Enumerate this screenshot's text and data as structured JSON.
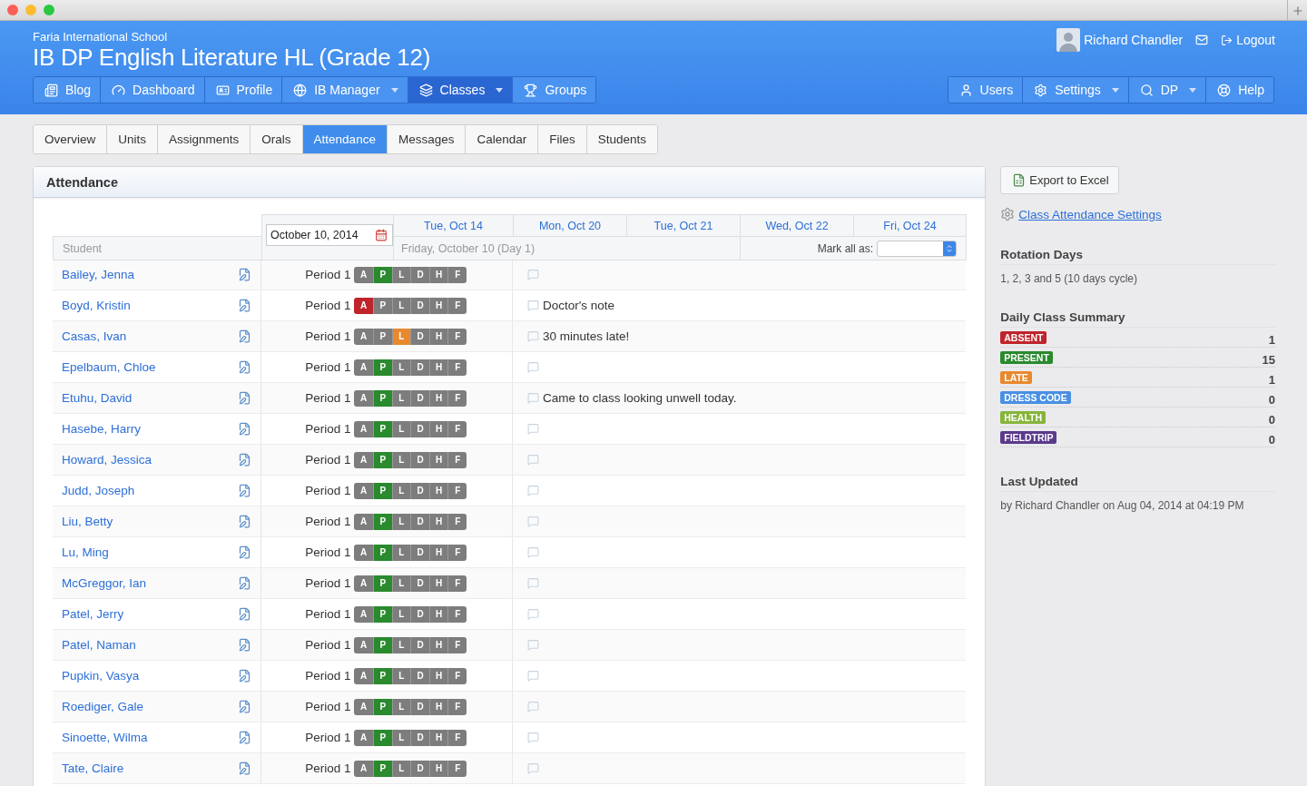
{
  "header": {
    "school": "Faria International School",
    "title": "IB DP English Literature HL (Grade 12)",
    "user": "Richard Chandler",
    "logout": "Logout"
  },
  "nav_left": [
    {
      "label": "Blog",
      "dropdown": false,
      "selected": false
    },
    {
      "label": "Dashboard",
      "dropdown": false,
      "selected": false
    },
    {
      "label": "Profile",
      "dropdown": false,
      "selected": false
    },
    {
      "label": "IB Manager",
      "dropdown": true,
      "selected": false
    },
    {
      "label": "Classes",
      "dropdown": true,
      "selected": true
    },
    {
      "label": "Groups",
      "dropdown": false,
      "selected": false
    }
  ],
  "nav_right": [
    {
      "label": "Users",
      "dropdown": false,
      "selected": false
    },
    {
      "label": "Settings",
      "dropdown": true,
      "selected": false
    },
    {
      "label": "DP",
      "dropdown": true,
      "selected": false
    },
    {
      "label": "Help",
      "dropdown": false,
      "selected": false
    }
  ],
  "tabs": [
    {
      "label": "Overview",
      "selected": false
    },
    {
      "label": "Units",
      "selected": false
    },
    {
      "label": "Assignments",
      "selected": false
    },
    {
      "label": "Orals",
      "selected": false
    },
    {
      "label": "Attendance",
      "selected": true
    },
    {
      "label": "Messages",
      "selected": false
    },
    {
      "label": "Calendar",
      "selected": false
    },
    {
      "label": "Files",
      "selected": false
    },
    {
      "label": "Students",
      "selected": false
    }
  ],
  "panel": {
    "title": "Attendance",
    "date_value": "October 10, 2014",
    "days": [
      "Tue, Oct 14",
      "Mon, Oct 20",
      "Tue, Oct 21",
      "Wed, Oct 22",
      "Fri, Oct 24"
    ],
    "student_header": "Student",
    "current_day": "Friday, October 10 (Day 1)",
    "mark_all_label": "Mark all as:"
  },
  "students": [
    {
      "name": "Bailey, Jenna",
      "period": "Period 1",
      "codes": [
        {
          "label": "A",
          "selected": false
        },
        {
          "label": "P",
          "selected": true
        },
        {
          "label": "L",
          "selected": false
        },
        {
          "label": "D",
          "selected": false
        },
        {
          "label": "H",
          "selected": false
        },
        {
          "label": "F",
          "selected": false
        }
      ]
    },
    {
      "name": "Boyd, Kristin",
      "period": "Period 1",
      "note": "Doctor's note",
      "codes": [
        {
          "label": "A",
          "selected": true
        },
        {
          "label": "P",
          "selected": false
        },
        {
          "label": "L",
          "selected": false
        },
        {
          "label": "D",
          "selected": false
        },
        {
          "label": "H",
          "selected": false
        },
        {
          "label": "F",
          "selected": false
        }
      ]
    },
    {
      "name": "Casas, Ivan",
      "period": "Period 1",
      "note": "30 minutes late!",
      "codes": [
        {
          "label": "A",
          "selected": false
        },
        {
          "label": "P",
          "selected": false
        },
        {
          "label": "L",
          "selected": true
        },
        {
          "label": "D",
          "selected": false
        },
        {
          "label": "H",
          "selected": false
        },
        {
          "label": "F",
          "selected": false
        }
      ]
    },
    {
      "name": "Epelbaum, Chloe",
      "period": "Period 1",
      "codes": [
        {
          "label": "A",
          "selected": false
        },
        {
          "label": "P",
          "selected": true
        },
        {
          "label": "L",
          "selected": false
        },
        {
          "label": "D",
          "selected": false
        },
        {
          "label": "H",
          "selected": false
        },
        {
          "label": "F",
          "selected": false
        }
      ]
    },
    {
      "name": "Etuhu, David",
      "period": "Period 1",
      "note": "Came to class looking unwell today.",
      "codes": [
        {
          "label": "A",
          "selected": false
        },
        {
          "label": "P",
          "selected": true
        },
        {
          "label": "L",
          "selected": false
        },
        {
          "label": "D",
          "selected": false
        },
        {
          "label": "H",
          "selected": false
        },
        {
          "label": "F",
          "selected": false
        }
      ]
    },
    {
      "name": "Hasebe, Harry",
      "period": "Period 1",
      "codes": [
        {
          "label": "A",
          "selected": false
        },
        {
          "label": "P",
          "selected": true
        },
        {
          "label": "L",
          "selected": false
        },
        {
          "label": "D",
          "selected": false
        },
        {
          "label": "H",
          "selected": false
        },
        {
          "label": "F",
          "selected": false
        }
      ]
    },
    {
      "name": "Howard, Jessica",
      "period": "Period 1",
      "codes": [
        {
          "label": "A",
          "selected": false
        },
        {
          "label": "P",
          "selected": true
        },
        {
          "label": "L",
          "selected": false
        },
        {
          "label": "D",
          "selected": false
        },
        {
          "label": "H",
          "selected": false
        },
        {
          "label": "F",
          "selected": false
        }
      ]
    },
    {
      "name": "Judd, Joseph",
      "period": "Period 1",
      "codes": [
        {
          "label": "A",
          "selected": false
        },
        {
          "label": "P",
          "selected": true
        },
        {
          "label": "L",
          "selected": false
        },
        {
          "label": "D",
          "selected": false
        },
        {
          "label": "H",
          "selected": false
        },
        {
          "label": "F",
          "selected": false
        }
      ]
    },
    {
      "name": "Liu, Betty",
      "period": "Period 1",
      "codes": [
        {
          "label": "A",
          "selected": false
        },
        {
          "label": "P",
          "selected": true
        },
        {
          "label": "L",
          "selected": false
        },
        {
          "label": "D",
          "selected": false
        },
        {
          "label": "H",
          "selected": false
        },
        {
          "label": "F",
          "selected": false
        }
      ]
    },
    {
      "name": "Lu, Ming",
      "period": "Period 1",
      "codes": [
        {
          "label": "A",
          "selected": false
        },
        {
          "label": "P",
          "selected": true
        },
        {
          "label": "L",
          "selected": false
        },
        {
          "label": "D",
          "selected": false
        },
        {
          "label": "H",
          "selected": false
        },
        {
          "label": "F",
          "selected": false
        }
      ]
    },
    {
      "name": "McGreggor, Ian",
      "period": "Period 1",
      "codes": [
        {
          "label": "A",
          "selected": false
        },
        {
          "label": "P",
          "selected": true
        },
        {
          "label": "L",
          "selected": false
        },
        {
          "label": "D",
          "selected": false
        },
        {
          "label": "H",
          "selected": false
        },
        {
          "label": "F",
          "selected": false
        }
      ]
    },
    {
      "name": "Patel, Jerry",
      "period": "Period 1",
      "codes": [
        {
          "label": "A",
          "selected": false
        },
        {
          "label": "P",
          "selected": true
        },
        {
          "label": "L",
          "selected": false
        },
        {
          "label": "D",
          "selected": false
        },
        {
          "label": "H",
          "selected": false
        },
        {
          "label": "F",
          "selected": false
        }
      ]
    },
    {
      "name": "Patel, Naman",
      "period": "Period 1",
      "codes": [
        {
          "label": "A",
          "selected": false
        },
        {
          "label": "P",
          "selected": true
        },
        {
          "label": "L",
          "selected": false
        },
        {
          "label": "D",
          "selected": false
        },
        {
          "label": "H",
          "selected": false
        },
        {
          "label": "F",
          "selected": false
        }
      ]
    },
    {
      "name": "Pupkin, Vasya",
      "period": "Period 1",
      "codes": [
        {
          "label": "A",
          "selected": false
        },
        {
          "label": "P",
          "selected": true
        },
        {
          "label": "L",
          "selected": false
        },
        {
          "label": "D",
          "selected": false
        },
        {
          "label": "H",
          "selected": false
        },
        {
          "label": "F",
          "selected": false
        }
      ]
    },
    {
      "name": "Roediger, Gale",
      "period": "Period 1",
      "codes": [
        {
          "label": "A",
          "selected": false
        },
        {
          "label": "P",
          "selected": true
        },
        {
          "label": "L",
          "selected": false
        },
        {
          "label": "D",
          "selected": false
        },
        {
          "label": "H",
          "selected": false
        },
        {
          "label": "F",
          "selected": false
        }
      ]
    },
    {
      "name": "Sinoette, Wilma",
      "period": "Period 1",
      "codes": [
        {
          "label": "A",
          "selected": false
        },
        {
          "label": "P",
          "selected": true
        },
        {
          "label": "L",
          "selected": false
        },
        {
          "label": "D",
          "selected": false
        },
        {
          "label": "H",
          "selected": false
        },
        {
          "label": "F",
          "selected": false
        }
      ]
    },
    {
      "name": "Tate, Claire",
      "period": "Period 1",
      "codes": [
        {
          "label": "A",
          "selected": false
        },
        {
          "label": "P",
          "selected": true
        },
        {
          "label": "L",
          "selected": false
        },
        {
          "label": "D",
          "selected": false
        },
        {
          "label": "H",
          "selected": false
        },
        {
          "label": "F",
          "selected": false
        }
      ]
    }
  ],
  "sidebar": {
    "export_label": "Export to Excel",
    "settings_link": "Class Attendance Settings",
    "rotation_title": "Rotation Days",
    "rotation_text": "1, 2, 3 and 5 (10 days cycle)",
    "summary_title": "Daily Class Summary",
    "updated_title": "Last Updated",
    "updated_text": "by Richard Chandler on Aug 04, 2014 at 04:19 PM"
  },
  "summary": [
    {
      "label": "ABSENT",
      "count": "1",
      "color": "#c0242b"
    },
    {
      "label": "PRESENT",
      "count": "15",
      "color": "#2a8a2e"
    },
    {
      "label": "LATE",
      "count": "1",
      "color": "#e8892e"
    },
    {
      "label": "DRESS CODE",
      "count": "0",
      "color": "#4a90e2"
    },
    {
      "label": "HEALTH",
      "count": "0",
      "color": "#86b53c"
    },
    {
      "label": "FIELDTRIP",
      "count": "0",
      "color": "#5b3a8c"
    }
  ]
}
